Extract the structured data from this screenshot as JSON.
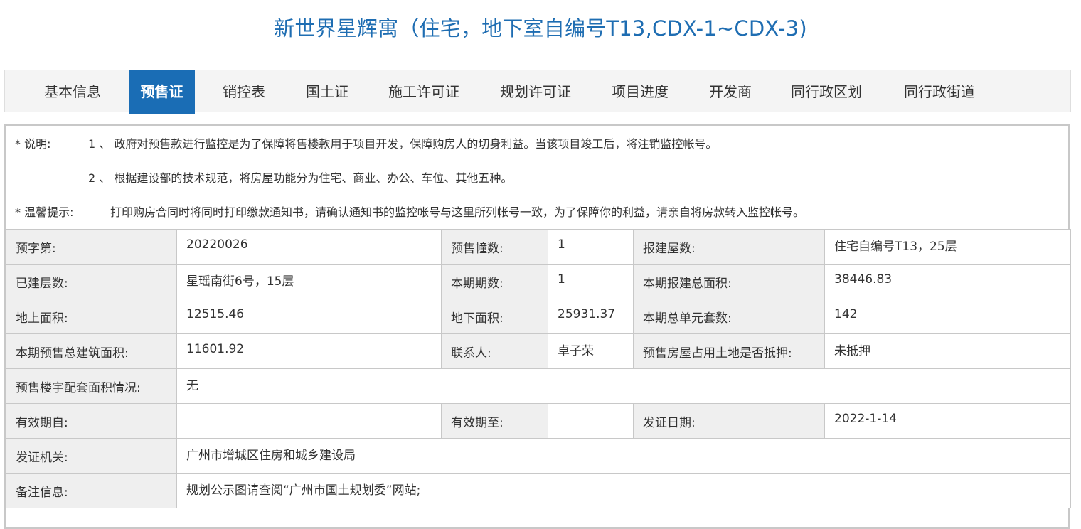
{
  "page": {
    "title": "新世界星辉寓（住宅，地下室自编号T13,CDX-1~CDX-3)"
  },
  "tabs": [
    {
      "label": "基本信息",
      "active": false
    },
    {
      "label": "预售证",
      "active": true
    },
    {
      "label": "销控表",
      "active": false
    },
    {
      "label": "国土证",
      "active": false
    },
    {
      "label": "施工许可证",
      "active": false
    },
    {
      "label": "规划许可证",
      "active": false
    },
    {
      "label": "项目进度",
      "active": false
    },
    {
      "label": "开发商",
      "active": false
    },
    {
      "label": "同行政区划",
      "active": false
    },
    {
      "label": "同行政街道",
      "active": false
    }
  ],
  "notes": {
    "explain_label": "* 说明:",
    "line1": "1 、 政府对预售款进行监控是为了保障将售楼款用于项目开发，保障购房人的切身利益。当该项目竣工后，将注销监控帐号。",
    "line2": "2 、 根据建设部的技术规范，将房屋功能分为住宅、商业、办公、车位、其他五种。",
    "tip_label": "* 温馨提示:",
    "tip_text": "打印购房合同时将同时打印缴款通知书，请确认通知书的监控帐号与这里所列帐号一致，为了保障你的利益，请亲自将房款转入监控帐号。"
  },
  "rows": {
    "r1": {
      "l1": "预字第:",
      "v1": "20220026",
      "l2": "预售幢数:",
      "v2": "1",
      "l3": "报建屋数:",
      "v3": "住宅自编号T13，25层"
    },
    "r2": {
      "l1": "已建层数:",
      "v1": "星瑶南街6号，15层",
      "l2": "本期期数:",
      "v2": "1",
      "l3": "本期报建总面积:",
      "v3": "38446.83"
    },
    "r3": {
      "l1": "地上面积:",
      "v1": "12515.46",
      "l2": "地下面积:",
      "v2": "25931.37",
      "l3": "本期总单元套数:",
      "v3": "142"
    },
    "r4": {
      "l1": "本期预售总建筑面积:",
      "v1": "11601.92",
      "l2": "联系人:",
      "v2": "卓子荣",
      "l3": "预售房屋占用土地是否抵押:",
      "v3": "未抵押"
    },
    "r5": {
      "l1": "预售楼宇配套面积情况:",
      "v1": "无"
    },
    "r6": {
      "l1": "有效期自:",
      "v1": "",
      "l2": "有效期至:",
      "v2": "",
      "l3": "发证日期:",
      "v3": "2022-1-14"
    },
    "r7": {
      "l1": "发证机关:",
      "v1": "广州市增城区住房和城乡建设局"
    },
    "r8": {
      "l1": "备注信息:",
      "v1": "规划公示图请查阅“广州市国土规划委”网站;"
    }
  }
}
